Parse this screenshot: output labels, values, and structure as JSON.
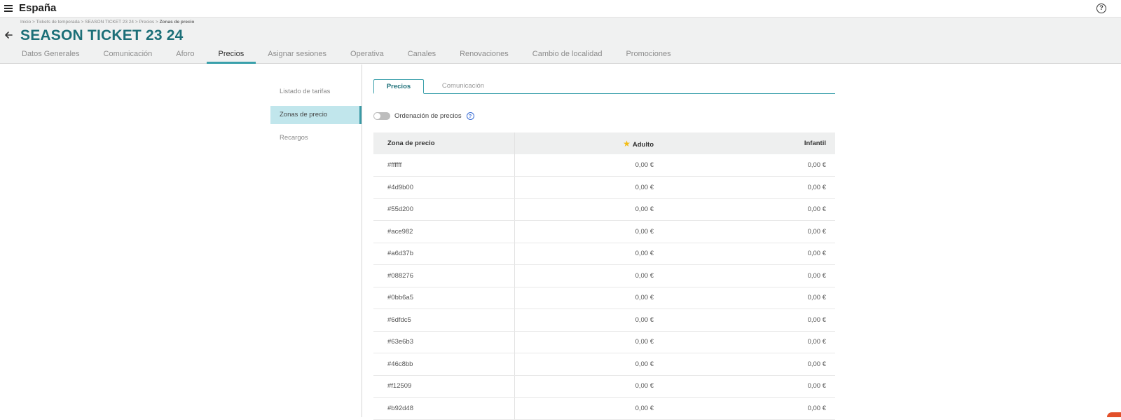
{
  "app": {
    "title": "España"
  },
  "header": {
    "breadcrumb": {
      "items": [
        "Inicio",
        "Tickets de temporada",
        "SEASON TICKET 23 24",
        "Precios"
      ],
      "separator": " > ",
      "current": "Zonas de precio"
    },
    "title": "SEASON TICKET 23 24",
    "tabs": [
      {
        "label": "Datos Generales"
      },
      {
        "label": "Comunicación"
      },
      {
        "label": "Aforo"
      },
      {
        "label": "Precios",
        "active": true
      },
      {
        "label": "Asignar sesiones"
      },
      {
        "label": "Operativa"
      },
      {
        "label": "Canales"
      },
      {
        "label": "Renovaciones"
      },
      {
        "label": "Cambio de localidad"
      },
      {
        "label": "Promociones"
      }
    ]
  },
  "subnav": {
    "items": [
      {
        "label": "Listado de tarifas"
      },
      {
        "label": "Zonas de precio",
        "active": true
      },
      {
        "label": "Recargos"
      }
    ]
  },
  "inner_tabs": {
    "active": "Precios",
    "other": "Comunicación"
  },
  "toggle": {
    "label": "Ordenación de precios",
    "on": false
  },
  "table": {
    "headers": {
      "zone": "Zona de precio",
      "adult": "Adulto",
      "child": "Infantil"
    },
    "rows": [
      {
        "zone": "#ffffff",
        "adult": "0,00 €",
        "child": "0,00 €"
      },
      {
        "zone": "#4d9b00",
        "adult": "0,00 €",
        "child": "0,00 €"
      },
      {
        "zone": "#55d200",
        "adult": "0,00 €",
        "child": "0,00 €"
      },
      {
        "zone": "#ace982",
        "adult": "0,00 €",
        "child": "0,00 €"
      },
      {
        "zone": "#a6d37b",
        "adult": "0,00 €",
        "child": "0,00 €"
      },
      {
        "zone": "#088276",
        "adult": "0,00 €",
        "child": "0,00 €"
      },
      {
        "zone": "#0bb6a5",
        "adult": "0,00 €",
        "child": "0,00 €"
      },
      {
        "zone": "#6dfdc5",
        "adult": "0,00 €",
        "child": "0,00 €"
      },
      {
        "zone": "#63e6b3",
        "adult": "0,00 €",
        "child": "0,00 €"
      },
      {
        "zone": "#46c8bb",
        "adult": "0,00 €",
        "child": "0,00 €"
      },
      {
        "zone": "#f12509",
        "adult": "0,00 €",
        "child": "0,00 €"
      },
      {
        "zone": "#b92d48",
        "adult": "0,00 €",
        "child": "0,00 €"
      }
    ]
  },
  "icons": {
    "menu": "hamburger-menu-icon",
    "help": "help-circle-icon",
    "back": "arrow-left-icon",
    "star": "star-icon"
  },
  "colors": {
    "brand_teal": "#1c6f78",
    "accent": "#3aa0ab",
    "active_subnav_bg": "#c1e6ec",
    "star": "#f3bc14",
    "help_blue": "#3b6ed6"
  }
}
